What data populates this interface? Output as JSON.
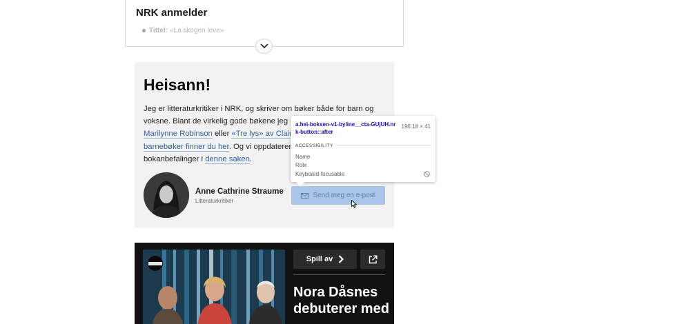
{
  "review_box": {
    "title": "NRK anmelder",
    "bullet_key": "Tittel:",
    "bullet_value": " «La skogen leve»"
  },
  "hei_box": {
    "heading": "Heisann!",
    "line1": "Jeg er litteraturkritiker i NRK, og skriver om bøker både for barn og",
    "line2_a": "voksne. Blant de virkelig gode bøkene jeg ha",
    "line3_link1": "Marilynne Robinson",
    "line3_mid": " eller ",
    "line3_link2": "«Tre lys» av Claire K",
    "line4_link": "barnebøker finner du her",
    "line4_rest": ". Og vi oppdaterer v",
    "line5_a": "bokanbefalinger i ",
    "line5_link": "denne saken",
    "line5_end": ".",
    "author_name": "Anne Cathrine Straume",
    "author_role": "Litteraturkritiker",
    "cta_label": "Send meg en e-post"
  },
  "devtools_tooltip": {
    "selector": "a.hei-boksen-v1-byline__cta-GUjUH.nrk-button::after",
    "size": "196.18 × 41",
    "section": "ACCESSIBILITY",
    "row_name": "Name",
    "row_role": "Role",
    "row_focus": "Keyboard-focusable"
  },
  "podcast": {
    "play_label": "Spill av",
    "headline": "Nora Dåsnes debuterer med"
  },
  "colors": {
    "link": "#2e5fa3",
    "cta_bg": "#a9c4e6",
    "tooltip_selector": "#1a0dab"
  }
}
